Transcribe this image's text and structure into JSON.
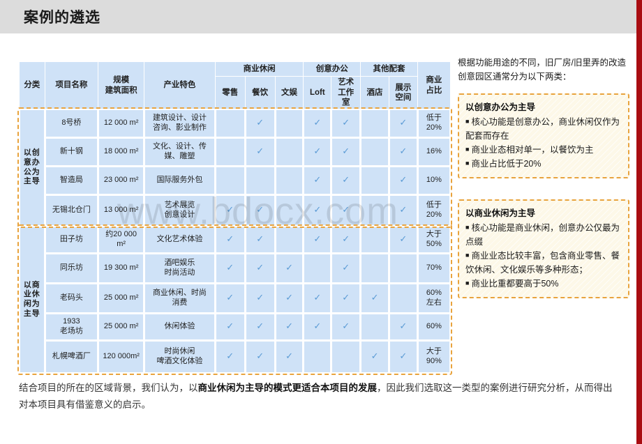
{
  "header": {
    "title": "案例的遴选",
    "accent_color": "#a90d12",
    "bar_color": "#dcdcdc"
  },
  "watermark": {
    "text": "www.bdocx.com"
  },
  "table": {
    "group_headers": {
      "commercial_leisure": "商业休闲",
      "creative_office": "创意办公",
      "other_support": "其他配套"
    },
    "columns": {
      "category": "分类",
      "project_name": "项目名称",
      "scale": "规模\n建筑面积",
      "scale_line1": "规模",
      "scale_line2": "建筑面积",
      "industry": "产业特色",
      "retail": "零售",
      "dining": "餐饮",
      "culture_ent": "文娱",
      "loft": "Loft",
      "art_studio": "艺术\n工作\n室",
      "art_studio_l1": "艺术",
      "art_studio_l2": "工作",
      "art_studio_l3": "室",
      "hotel": "酒店",
      "exhibition": "展示\n空间",
      "exhibition_l1": "展示",
      "exhibition_l2": "空间",
      "commercial_ratio": "商业\n占比",
      "commercial_ratio_l1": "商业",
      "commercial_ratio_l2": "占比"
    },
    "groups": [
      {
        "category": "以创意办公为主导",
        "rows": [
          {
            "name": "8号桥",
            "area": "12 000 m²",
            "industry": "建筑设计、设计\n咨询、影业制作",
            "retail": false,
            "dining": true,
            "culture_ent": false,
            "loft": true,
            "art_studio": true,
            "hotel": false,
            "exhibition": true,
            "ratio": "低于\n20%"
          },
          {
            "name": "新十钢",
            "area": "18 000 m²",
            "industry": "文化、设计、传\n媒、雕塑",
            "retail": false,
            "dining": true,
            "culture_ent": false,
            "loft": true,
            "art_studio": true,
            "hotel": false,
            "exhibition": true,
            "ratio": "16%"
          },
          {
            "name": "智造局",
            "area": "23 000 m²",
            "industry": "国际服务外包",
            "retail": false,
            "dining": false,
            "culture_ent": false,
            "loft": true,
            "art_studio": true,
            "hotel": false,
            "exhibition": true,
            "ratio": "10%"
          },
          {
            "name": "无锡北仓门",
            "area": "13 000 m²",
            "industry": "艺术展览\n创意设计",
            "retail": true,
            "dining": true,
            "culture_ent": false,
            "loft": true,
            "art_studio": true,
            "hotel": false,
            "exhibition": true,
            "ratio": "低于\n20%"
          }
        ]
      },
      {
        "category": "以商业休闲为主导",
        "rows": [
          {
            "name": "田子坊",
            "area": "约20 000 m²",
            "industry": "文化艺术体验",
            "retail": true,
            "dining": true,
            "culture_ent": false,
            "loft": true,
            "art_studio": true,
            "hotel": false,
            "exhibition": true,
            "ratio": "大于\n50%"
          },
          {
            "name": "同乐坊",
            "area": "19 300 m²",
            "industry": "酒吧娱乐\n时尚活动",
            "retail": true,
            "dining": true,
            "culture_ent": true,
            "loft": false,
            "art_studio": true,
            "hotel": false,
            "exhibition": false,
            "ratio": "70%"
          },
          {
            "name": "老码头",
            "area": "25 000 m²",
            "industry": "商业休闲、时尚\n消费",
            "retail": true,
            "dining": true,
            "culture_ent": true,
            "loft": true,
            "art_studio": true,
            "hotel": true,
            "exhibition": false,
            "ratio": "60%\n左右"
          },
          {
            "name": "1933\n老场坊",
            "area": "25 000 m²",
            "industry": "休闲体验",
            "retail": true,
            "dining": true,
            "culture_ent": true,
            "loft": true,
            "art_studio": true,
            "hotel": false,
            "exhibition": true,
            "ratio": "60%"
          },
          {
            "name": "札幌啤酒厂",
            "area": "120 000m²",
            "industry": "时尚休闲\n啤酒文化体验",
            "retail": true,
            "dining": true,
            "culture_ent": true,
            "loft": false,
            "art_studio": false,
            "hotel": true,
            "exhibition": true,
            "ratio": "大于\n90%"
          }
        ]
      }
    ],
    "check_glyph": "✓",
    "check_color": "#5b9bd5"
  },
  "side": {
    "intro": "根据功能用途的不同，旧厂房/旧里弄的改造创意园区通常分为以下两类：",
    "boxes": [
      {
        "title": "以创意办公为主导",
        "bullets": [
          "核心功能是创意办公，商业休闲仅作为配套而存在",
          "商业业态相对单一，以餐饮为主",
          "商业占比低于20%"
        ]
      },
      {
        "title": "以商业休闲为主导",
        "bullets": [
          "核心功能是商业休闲，创意办公仅最为点缀",
          "商业业态比较丰富，包含商业零售、餐饮休闲、文化娱乐等多种形态；",
          "商业比重都要高于50%"
        ]
      }
    ],
    "bullet_glyph": "■"
  },
  "footer": {
    "part1": "结合项目的所在的区域背景，我们认为，以",
    "bold": "商业休闲为主导的模式更适合本项目的发展",
    "part2": "，因此我们选取这一类型的案例进行研究分析，从而得出对本项目具有借鉴意义的启示。"
  }
}
